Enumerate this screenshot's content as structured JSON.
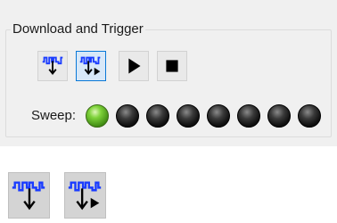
{
  "trigger_group": {
    "title": "Download and Trigger",
    "buttons": [
      {
        "name": "download-trigger-button",
        "icon": "trigger-waveform-icon",
        "selected": false
      },
      {
        "name": "download-trigger-run-button",
        "icon": "trigger-waveform-run-icon",
        "selected": true
      },
      {
        "name": "play-button",
        "icon": "play-icon",
        "selected": false
      },
      {
        "name": "stop-button",
        "icon": "stop-icon",
        "selected": false
      }
    ],
    "sweep_label": "Sweep:",
    "sweep_leds": {
      "count": 8,
      "active_index": 0
    }
  },
  "large_icons": [
    {
      "name": "trigger-waveform-large-icon"
    },
    {
      "name": "trigger-waveform-run-large-icon"
    }
  ],
  "colors": {
    "waveform_blue": "#1a3cff",
    "led_on_green": "#6cc42b",
    "led_off": "#1a1a1a",
    "selected_border": "#0a78d7"
  }
}
